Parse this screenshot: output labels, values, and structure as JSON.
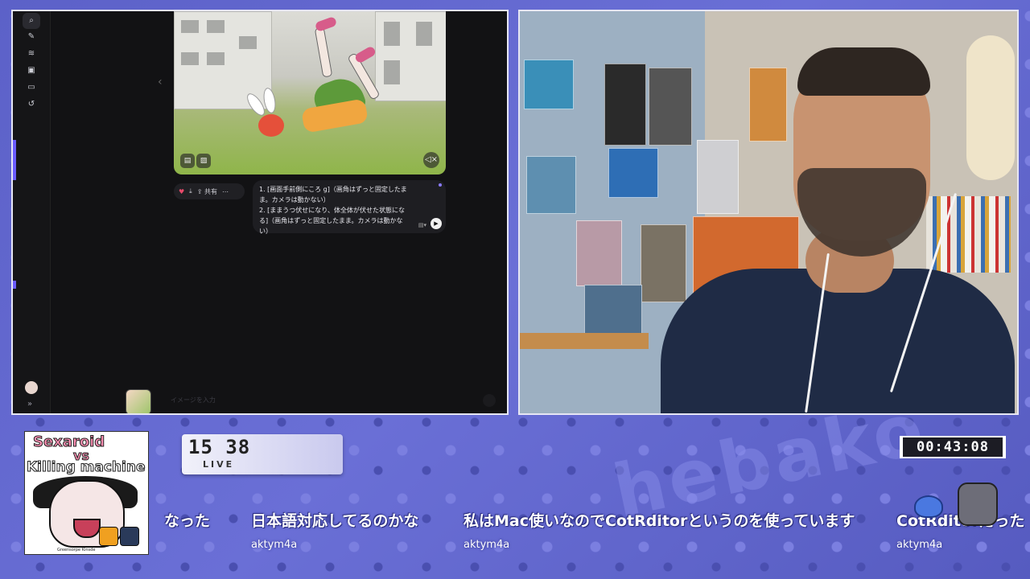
{
  "screen": {
    "sidebar_icons": [
      "search-icon",
      "edit-icon",
      "waveform-icon",
      "image-icon",
      "folder-icon",
      "history-icon"
    ],
    "actions": {
      "share_label": "共有"
    },
    "prompt": {
      "line1": "1. [画面手前側にころ g]（画角はずっと固定したま",
      "line2": "ま。カメラは動かない）",
      "line3": "2. [ままうつ伏せになり、体全体が伏せた状態にな",
      "line4": "る]（画角はずっと固定したまま。カメラは動かな",
      "line5": "い）"
    },
    "input_placeholder": "イメージを入力"
  },
  "cover": {
    "title_line1": "Sexaroid",
    "title_vs": "vs",
    "title_line3": "Killing machine",
    "credit": "Greensorpe Kinsde"
  },
  "clock": {
    "time": "15 38",
    "status": "LIVE"
  },
  "timer": {
    "elapsed": "00:43:08"
  },
  "chat": [
    {
      "text": "なった",
      "user": ""
    },
    {
      "text": "日本語対応してるのかな",
      "user": "aktym4a"
    },
    {
      "text": "私はMac使いなのでCotRditorというのを使っています",
      "user": "aktym4a"
    },
    {
      "text": "CotRditorだった",
      "user": "aktym4a"
    }
  ],
  "colors": {
    "accent": "#6b5cff",
    "bg": "#5a5fc4",
    "panel_border": "#e6e6f4"
  }
}
